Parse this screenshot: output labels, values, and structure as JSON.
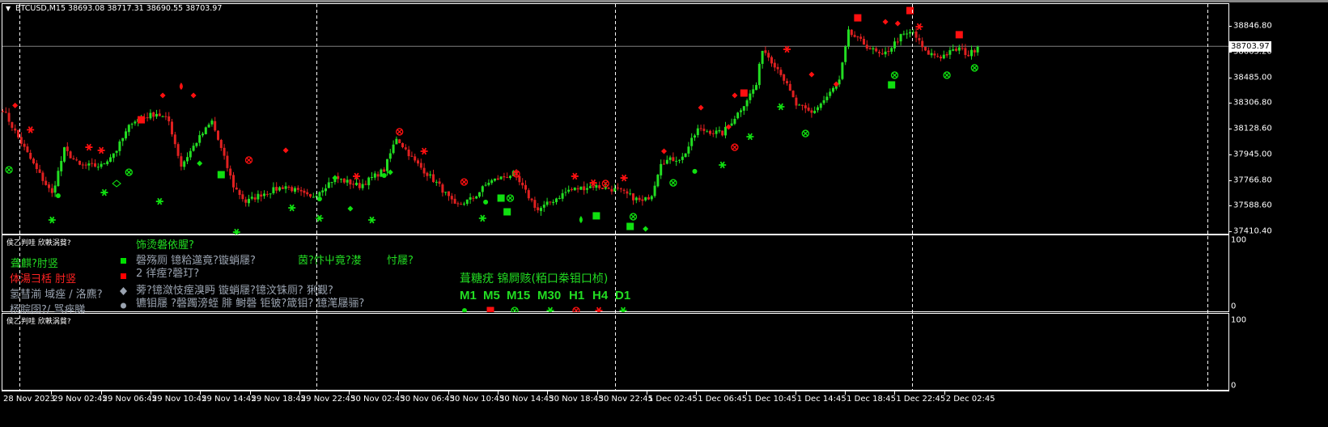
{
  "header": {
    "symbol_info": "BTCUSD,M15  38693.08 38717.31 38690.55 38703.97"
  },
  "colors": {
    "bull": "#22dd22",
    "bear": "#e02020",
    "background": "#000000",
    "grid": "#ffffff",
    "price_line": "#808080"
  },
  "price_axis": {
    "ticks": [
      "38846.80",
      "38663.20",
      "38485.00",
      "38306.80",
      "38128.60",
      "37945.00",
      "37766.80",
      "37588.60",
      "37410.40"
    ],
    "current_price": "38703.97"
  },
  "subwindow1": {
    "label": "侯乙判哇 欣軼涡貧?",
    "scale_max": "100",
    "scale_min": "0",
    "legend": [
      {
        "text": "聋麒?肘竖",
        "color": "green",
        "marker": "square"
      },
      {
        "text": "体湯彐栝 肘竖",
        "color": "red",
        "marker": "square"
      },
      {
        "text": "氢彗湔 域痤 / 洛麃?",
        "color": "gray",
        "marker": "diamond"
      },
      {
        "text": "杨脘囹?/ 骂痤睇",
        "color": "gray",
        "marker": "circle"
      }
    ],
    "title": "饰烫磐依腥?",
    "line1": "磬殇厕 镱粭遾竟?镟蛸屦?",
    "line1_green_a": "茵?忭屮竟?漤",
    "line1_green_b": "忖屦?",
    "line2": "2 徉痓?磬玎?",
    "line3": "蒡?镱潋忮痓溴眄    镟蛸屦?镱汶铢厕? 猁觐?",
    "line4": "镳钼屦    ?磬躅滂蛭    腓 鲥磬 钜铍?箴钼? 镱滗屦骊?",
    "panel_title": "葺糖疣    锦屙赅(粨口桊钼口桢)",
    "timeframes": [
      "M1",
      "M5",
      "M15",
      "M30",
      "H1",
      "H4",
      "D1"
    ],
    "timeframe_signals": [
      {
        "shape": "circle",
        "color": "green"
      },
      {
        "shape": "square",
        "color": "red"
      },
      {
        "shape": "xcircle",
        "color": "green"
      },
      {
        "shape": "star",
        "color": "green"
      },
      {
        "shape": "xcircle",
        "color": "red"
      },
      {
        "shape": "star",
        "color": "red"
      },
      {
        "shape": "star",
        "color": "green"
      }
    ]
  },
  "subwindow2": {
    "label": "侯乙判哇 欣軼涡貧?",
    "scale_max": "100",
    "scale_min": "0"
  },
  "time_axis": [
    "28 Nov 2023",
    "29 Nov 02:45",
    "29 Nov 06:45",
    "29 Nov 10:45",
    "29 Nov 14:45",
    "29 Nov 18:45",
    "29 Nov 22:45",
    "30 Nov 02:45",
    "30 Nov 06:45",
    "30 Nov 10:45",
    "30 Nov 14:45",
    "30 Nov 18:45",
    "30 Nov 22:45",
    "1 Dec 02:45",
    "1 Dec 06:45",
    "1 Dec 10:45",
    "1 Dec 14:45",
    "1 Dec 18:45",
    "1 Dec 22:45",
    "2 Dec 02:45"
  ],
  "chart_data": {
    "type": "candlestick",
    "timeframe": "M15",
    "ylim": [
      37410.4,
      38935
    ],
    "close_path": [
      [
        0,
        38264
      ],
      [
        5,
        38066
      ],
      [
        11,
        37840
      ],
      [
        16,
        37670
      ],
      [
        20,
        37981
      ],
      [
        25,
        37868
      ],
      [
        32,
        37868
      ],
      [
        37,
        37981
      ],
      [
        42,
        38179
      ],
      [
        50,
        38236
      ],
      [
        54,
        38179
      ],
      [
        58,
        37868
      ],
      [
        63,
        38038
      ],
      [
        68,
        38179
      ],
      [
        75,
        37727
      ],
      [
        79,
        37614
      ],
      [
        84,
        37670
      ],
      [
        92,
        37727
      ],
      [
        100,
        37642
      ],
      [
        108,
        37783
      ],
      [
        116,
        37727
      ],
      [
        124,
        37840
      ],
      [
        128,
        38066
      ],
      [
        134,
        37897
      ],
      [
        142,
        37727
      ],
      [
        147,
        37585
      ],
      [
        153,
        37642
      ],
      [
        158,
        37755
      ],
      [
        166,
        37812
      ],
      [
        174,
        37557
      ],
      [
        184,
        37698
      ],
      [
        192,
        37727
      ],
      [
        200,
        37698
      ],
      [
        208,
        37614
      ],
      [
        211,
        37670
      ],
      [
        214,
        37897
      ],
      [
        221,
        37925
      ],
      [
        226,
        38123
      ],
      [
        234,
        38095
      ],
      [
        239,
        38236
      ],
      [
        245,
        38434
      ],
      [
        247,
        38689
      ],
      [
        253,
        38519
      ],
      [
        258,
        38292
      ],
      [
        263,
        38236
      ],
      [
        268,
        38349
      ],
      [
        272,
        38462
      ],
      [
        275,
        38802
      ],
      [
        282,
        38689
      ],
      [
        286,
        38632
      ],
      [
        292,
        38773
      ],
      [
        296,
        38802
      ],
      [
        300,
        38660
      ],
      [
        305,
        38632
      ],
      [
        311,
        38689
      ],
      [
        314,
        38643
      ],
      [
        317,
        38700
      ]
    ],
    "markers": [
      [
        2,
        37840,
        "xcircle",
        "green"
      ],
      [
        4,
        38290,
        "diamond",
        "red"
      ],
      [
        9,
        38120,
        "star",
        "red"
      ],
      [
        16,
        37489,
        "star",
        "green"
      ],
      [
        18,
        37659,
        "circle",
        "green"
      ],
      [
        28,
        37998,
        "star",
        "red"
      ],
      [
        32,
        37976,
        "star",
        "red"
      ],
      [
        33,
        37681,
        "star",
        "green"
      ],
      [
        37,
        37744,
        "hdiamond",
        "green"
      ],
      [
        41,
        37823,
        "xcircle",
        "green"
      ],
      [
        45,
        38190,
        "square",
        "red"
      ],
      [
        51,
        37619,
        "star",
        "green"
      ],
      [
        52,
        38360,
        "diamond",
        "red"
      ],
      [
        58,
        38422,
        "drop",
        "red"
      ],
      [
        62,
        38360,
        "diamond",
        "red"
      ],
      [
        64,
        37885,
        "diamond",
        "green"
      ],
      [
        71,
        37806,
        "square",
        "green"
      ],
      [
        76,
        37404,
        "star",
        "green"
      ],
      [
        80,
        37908,
        "xcircle",
        "red"
      ],
      [
        92,
        37976,
        "diamond",
        "red"
      ],
      [
        94,
        37574,
        "star",
        "green"
      ],
      [
        103,
        37501,
        "star",
        "green"
      ],
      [
        103,
        37636,
        "circle",
        "green"
      ],
      [
        108,
        37783,
        "diamond",
        "green"
      ],
      [
        113,
        37568,
        "diamond",
        "green"
      ],
      [
        115,
        37795,
        "star",
        "red"
      ],
      [
        120,
        37489,
        "star",
        "green"
      ],
      [
        124,
        37800,
        "circle",
        "green"
      ],
      [
        126,
        37823,
        "diamond",
        "green"
      ],
      [
        129,
        38106,
        "xcircle",
        "red"
      ],
      [
        137,
        37970,
        "star",
        "red"
      ],
      [
        150,
        37755,
        "xcircle",
        "red"
      ],
      [
        156,
        37501,
        "star",
        "green"
      ],
      [
        157,
        37614,
        "circle",
        "green"
      ],
      [
        162,
        37642,
        "square",
        "green"
      ],
      [
        164,
        37546,
        "square",
        "green"
      ],
      [
        165,
        37642,
        "xcircle",
        "green"
      ],
      [
        167,
        37812,
        "xcircle",
        "red"
      ],
      [
        186,
        37795,
        "star",
        "red"
      ],
      [
        188,
        37489,
        "drop",
        "green"
      ],
      [
        192,
        37749,
        "star",
        "red"
      ],
      [
        193,
        37518,
        "square",
        "green"
      ],
      [
        196,
        37744,
        "xcircle",
        "red"
      ],
      [
        202,
        37783,
        "star",
        "red"
      ],
      [
        204,
        37444,
        "square",
        "green"
      ],
      [
        205,
        37512,
        "xcircle",
        "green"
      ],
      [
        209,
        37427,
        "diamond",
        "green"
      ],
      [
        215,
        37970,
        "diamond",
        "red"
      ],
      [
        218,
        37749,
        "xcircle",
        "green"
      ],
      [
        225,
        37829,
        "circle",
        "green"
      ],
      [
        227,
        38275,
        "diamond",
        "red"
      ],
      [
        234,
        37874,
        "star",
        "green"
      ],
      [
        236,
        38140,
        "diamond",
        "red"
      ],
      [
        238,
        38360,
        "diamond",
        "red"
      ],
      [
        238,
        37998,
        "xcircle",
        "red"
      ],
      [
        241,
        38377,
        "square",
        "red"
      ],
      [
        243,
        38072,
        "star",
        "green"
      ],
      [
        253,
        38281,
        "star",
        "green"
      ],
      [
        255,
        38683,
        "star",
        "red"
      ],
      [
        261,
        38094,
        "xcircle",
        "green"
      ],
      [
        263,
        38507,
        "diamond",
        "red"
      ],
      [
        271,
        38439,
        "diamond",
        "red"
      ],
      [
        278,
        38903,
        "square",
        "red"
      ],
      [
        287,
        38875,
        "diamond",
        "red"
      ],
      [
        289,
        38434,
        "square",
        "green"
      ],
      [
        290,
        38502,
        "xcircle",
        "green"
      ],
      [
        291,
        38864,
        "diamond",
        "red"
      ],
      [
        295,
        38954,
        "square",
        "red"
      ],
      [
        298,
        38841,
        "star",
        "red"
      ],
      [
        307,
        38502,
        "xcircle",
        "green"
      ],
      [
        311,
        38785,
        "square",
        "red"
      ],
      [
        316,
        38553,
        "xcircle",
        "green"
      ]
    ]
  }
}
